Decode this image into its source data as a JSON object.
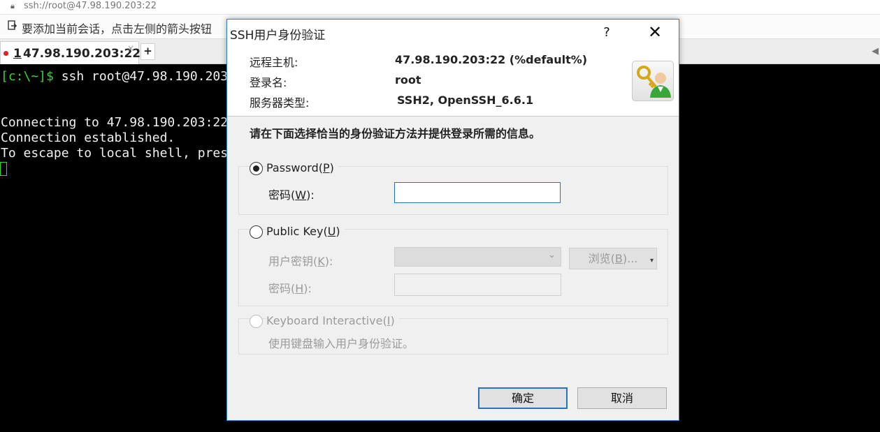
{
  "browser": {
    "address": "ssh://root@47.98.190.203:22"
  },
  "hintbar": {
    "text": "要添加当前会话，点击左侧的箭头按钮"
  },
  "tabs": [
    {
      "number": "1",
      "host": "47.98.190.203:22",
      "close": "×"
    }
  ],
  "add_tab_label": "+",
  "terminal": {
    "prompt": "[c:\\~]$",
    "command": " ssh root@47.98.190.203",
    "lines": [
      "Connecting to 47.98.190.203:22",
      "Connection established.",
      "To escape to local shell, pres"
    ]
  },
  "dialog": {
    "title": "SSH用户身份验证",
    "help": "?",
    "close": "✕",
    "info": {
      "remote_host_label": "远程主机:",
      "remote_host_value": "47.98.190.203:22 (%default%)",
      "login_label": "登录名:",
      "login_value": "root",
      "server_type_label": "服务器类型:",
      "server_type_value": "SSH2, OpenSSH_6.6.1"
    },
    "instruction": "请在下面选择恰当的身份验证方法并提供登录所需的信息。",
    "password_method": {
      "label_text": "Password(",
      "label_accel": "P",
      "label_end": ")",
      "checked": true,
      "field_label_text": "密码(",
      "field_label_accel": "W",
      "field_label_end": "):",
      "value": ""
    },
    "publickey_method": {
      "label_text": "Public Key(",
      "label_accel": "U",
      "label_end": ")",
      "checked": false,
      "key_label_text": "用户密钥(",
      "key_label_accel": "K",
      "key_label_end": "):",
      "browse_text": "浏览(",
      "browse_accel": "B",
      "browse_end": ")...",
      "pass_label_text": "密码(",
      "pass_label_accel": "H",
      "pass_label_end": "):"
    },
    "keyboard_method": {
      "label_text": "Keyboard Interactive(",
      "label_accel": "I",
      "label_end": ")",
      "desc": "使用键盘输入用户身份验证。"
    },
    "ok_label": "确定",
    "cancel_label": "取消"
  }
}
